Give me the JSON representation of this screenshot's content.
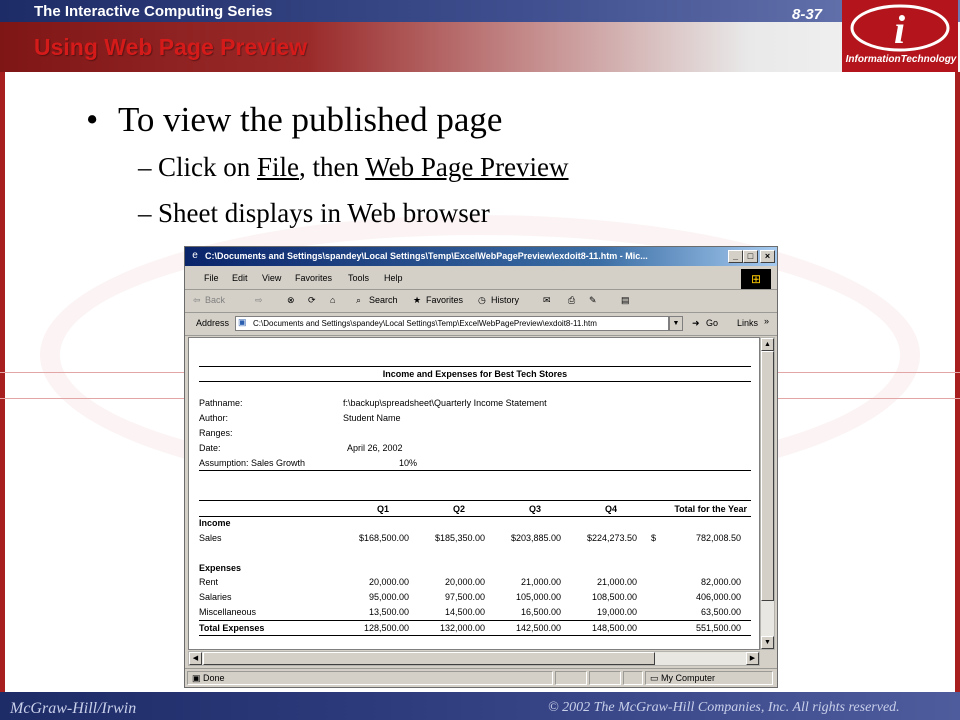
{
  "slide": {
    "series": "The Interactive Computing Series",
    "page_number": "8-37",
    "title": "Using Web Page Preview",
    "logo_text": "InformationTechnology",
    "bullet": "To view the published page",
    "sub1_prefix": "Click on ",
    "sub1_file": "File",
    "sub1_middle": ", then ",
    "sub1_wpp": "Web Page Preview",
    "sub2": "Sheet displays in Web browser",
    "publisher": "McGraw-Hill/Irwin",
    "copyright": "© 2002  The McGraw-Hill Companies, Inc. All rights reserved."
  },
  "browser": {
    "title": "C:\\Documents and Settings\\spandey\\Local Settings\\Temp\\ExcelWebPagePreview\\exdoit8-11.htm - Mic...",
    "menu": [
      "File",
      "Edit",
      "View",
      "Favorites",
      "Tools",
      "Help"
    ],
    "toolbar": {
      "back": "Back",
      "search": "Search",
      "favorites": "Favorites",
      "history": "History"
    },
    "address_label": "Address",
    "address_value": "C:\\Documents and Settings\\spandey\\Local Settings\\Temp\\ExcelWebPagePreview\\exdoit8-11.htm",
    "go": "Go",
    "links": "Links",
    "status": "Done",
    "zone": "My Computer"
  },
  "sheet": {
    "title": "Income and Expenses for Best Tech Stores",
    "info_labels": [
      "Pathname:",
      "Author:",
      "Ranges:",
      "Date:",
      "Assumption: Sales Growth"
    ],
    "info_values": [
      "f:\\backup\\spreadsheet\\Quarterly Income Statement",
      "Student Name",
      "",
      "April 26, 2002",
      "10%"
    ],
    "columns": [
      "Q1",
      "Q2",
      "Q3",
      "Q4",
      "Total for the Year"
    ],
    "income_label": "Income",
    "sales": {
      "label": "Sales",
      "values": [
        "$168,500.00",
        "$185,350.00",
        "$203,885.00",
        "$224,273.50"
      ],
      "currency": "$",
      "total": "782,008.50"
    },
    "expenses_label": "Expenses",
    "expense_rows": [
      {
        "label": "Rent",
        "values": [
          "20,000.00",
          "20,000.00",
          "21,000.00",
          "21,000.00",
          "82,000.00"
        ]
      },
      {
        "label": "Salaries",
        "values": [
          "95,000.00",
          "97,500.00",
          "105,000.00",
          "108,500.00",
          "406,000.00"
        ]
      },
      {
        "label": "Miscellaneous",
        "values": [
          "13,500.00",
          "14,500.00",
          "16,500.00",
          "19,000.00",
          "63,500.00"
        ]
      }
    ],
    "total_row": {
      "label": "Total Expenses",
      "values": [
        "128,500.00",
        "132,000.00",
        "142,500.00",
        "148,500.00",
        "551,500.00"
      ]
    }
  },
  "colors": {
    "title_red": "#d51a1a",
    "frame_blue": "#1d2b66",
    "frame_red": "#a81f1f"
  }
}
